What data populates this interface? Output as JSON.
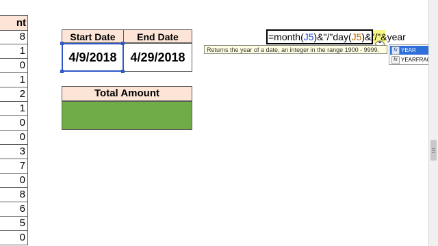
{
  "left_column": {
    "header_partial": "nt",
    "values": [
      "8",
      "1",
      "0",
      "1",
      "2",
      "1",
      "0",
      "0",
      "3",
      "7",
      "0",
      "8",
      "6",
      "5",
      "0"
    ]
  },
  "date_table": {
    "start_header": "Start Date",
    "end_header": "End Date",
    "start_value": "4/9/2018",
    "end_value": "4/29/2018"
  },
  "total_amount": {
    "header": "Total Amount",
    "fill_color": "#70ad47"
  },
  "formula": {
    "p1": "=month(",
    "ref1": "J5",
    "p2": ")&\"/\"day(",
    "ref2": "J5",
    "p3": ")&\"/\"&year"
  },
  "tooltip": {
    "text": "Returns the year of a date, an integer in the range 1900 - 9999."
  },
  "autocomplete": {
    "items": [
      {
        "label": "YEAR",
        "icon": "function-icon",
        "selected": true
      },
      {
        "label": "YEARFRAC",
        "icon": "function-icon",
        "selected": false
      }
    ]
  },
  "colors": {
    "header_fill": "#fce4d6",
    "selection_blue": "#2f57c9",
    "highlight_yellow": "#f4f46a"
  }
}
